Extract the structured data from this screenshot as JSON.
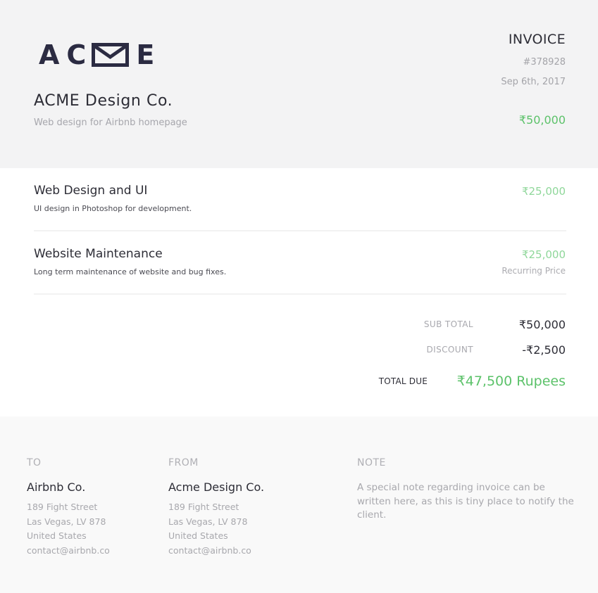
{
  "logo": {
    "letters": [
      "A",
      "C",
      "E"
    ],
    "icon": "envelope-icon",
    "text": "ACME"
  },
  "company": {
    "name": "ACME Design Co.",
    "description": "Web design for Airbnb homepage"
  },
  "invoice": {
    "title": "INVOICE",
    "number": "#378928",
    "date": "Sep 6th, 2017",
    "amount": "₹50,000"
  },
  "items": [
    {
      "title": "Web Design and UI",
      "description": "UI design in Photoshop for development.",
      "price": "₹25,000"
    },
    {
      "title": "Website Maintenance",
      "description": "Long term maintenance of website and bug fixes.",
      "price": "₹25,000",
      "note": "Recurring Price"
    }
  ],
  "totals": {
    "subtotal_label": "SUB TOTAL",
    "subtotal_value": "₹50,000",
    "discount_label": "DISCOUNT",
    "discount_value": "-₹2,500",
    "total_due_label": "TOTAL DUE",
    "total_due_value": "₹47,500 Rupees"
  },
  "footer": {
    "to": {
      "label": "TO",
      "name": "Airbnb Co.",
      "street": "189 Fight Street",
      "city": "Las Vegas, LV 878",
      "country": "United States",
      "email": "contact@airbnb.co"
    },
    "from": {
      "label": "FROM",
      "name": "Acme Design Co.",
      "street": "189 Fight Street",
      "city": "Las Vegas, LV 878",
      "country": "United States",
      "email": "contact@airbnb.co"
    },
    "note": {
      "label": "NOTE",
      "text": "A special note regarding invoice can be written here, as this is tiny place to notify the client."
    }
  },
  "colors": {
    "accent_green": "#5cc26a",
    "accent_green_light": "#8fd79a",
    "logo_navy": "#2b2b42",
    "header_bg": "#f3f3f4",
    "footer_bg": "#f9f9f9"
  }
}
